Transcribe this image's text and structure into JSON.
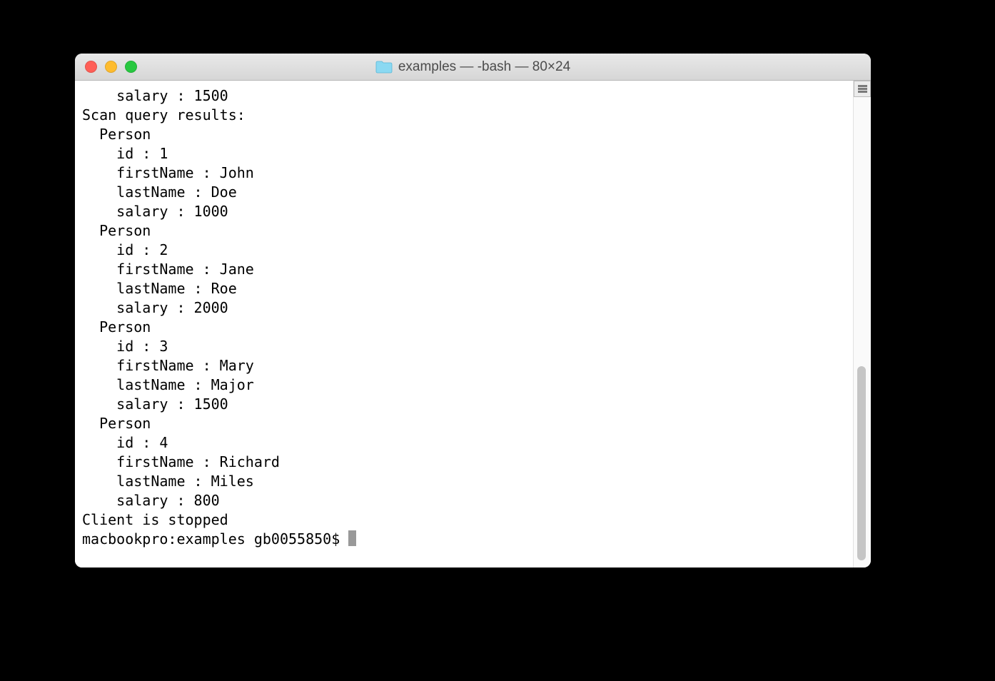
{
  "window": {
    "title": "examples — -bash — 80×24"
  },
  "terminal": {
    "lines": [
      "    salary : 1500",
      "Scan query results:",
      "  Person",
      "    id : 1",
      "    firstName : John",
      "    lastName : Doe",
      "    salary : 1000",
      "  Person",
      "    id : 2",
      "    firstName : Jane",
      "    lastName : Roe",
      "    salary : 2000",
      "  Person",
      "    id : 3",
      "    firstName : Mary",
      "    lastName : Major",
      "    salary : 1500",
      "  Person",
      "    id : 4",
      "    firstName : Richard",
      "    lastName : Miles",
      "    salary : 800",
      "Client is stopped"
    ],
    "prompt": "macbookpro:examples gb0055850$ "
  }
}
